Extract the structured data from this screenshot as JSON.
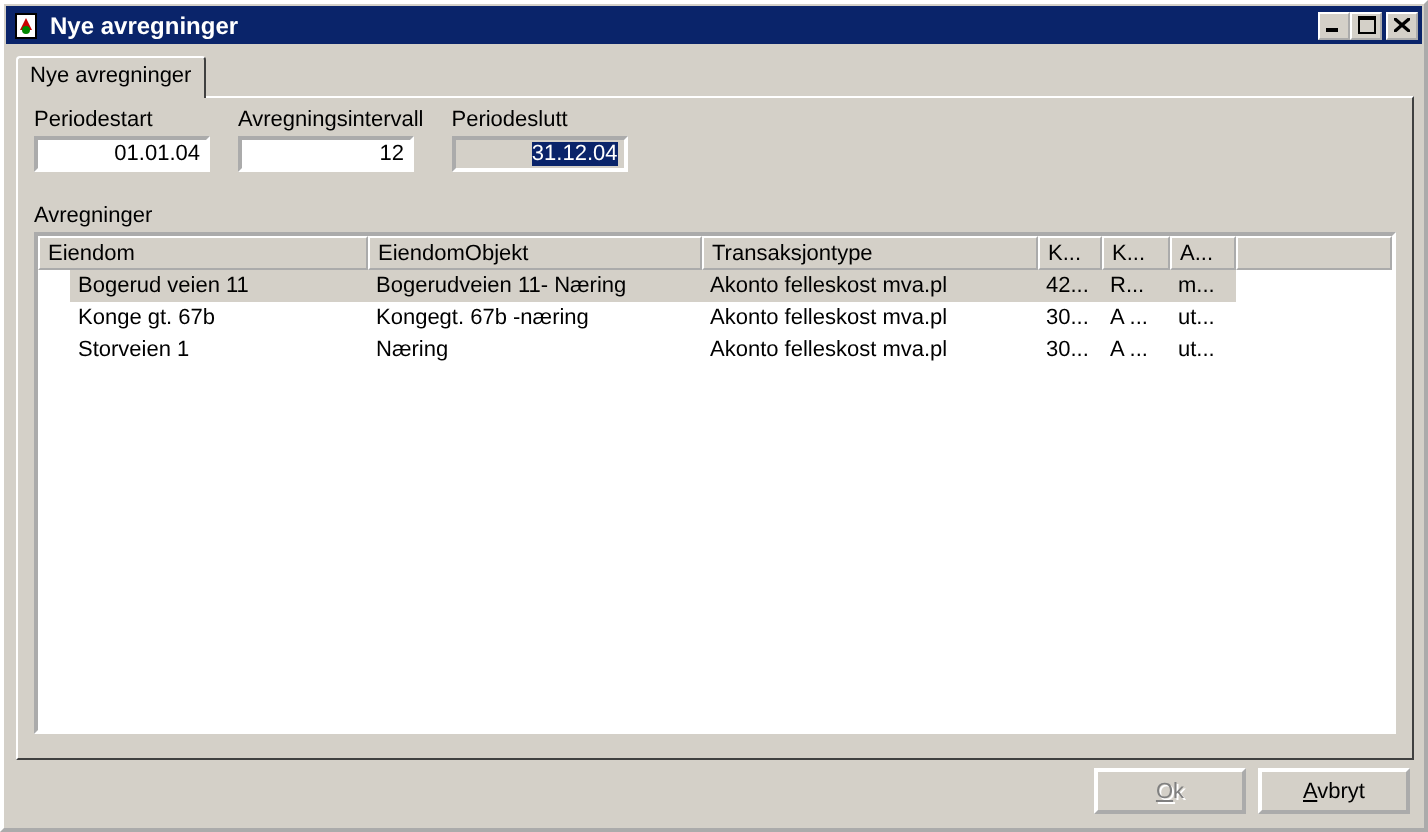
{
  "window": {
    "title": "Nye avregninger"
  },
  "tabs": [
    {
      "label": "Nye avregninger",
      "selected": true
    }
  ],
  "fields": [
    {
      "label": "Periodestart",
      "value": "01.01.04",
      "disabled": false,
      "text_selected": false
    },
    {
      "label": "Avregningsintervall",
      "value": "12",
      "disabled": false,
      "text_selected": false
    },
    {
      "label": "Periodeslutt",
      "value": "31.12.04",
      "disabled": true,
      "text_selected": true
    }
  ],
  "table": {
    "title": "Avregninger",
    "columns": [
      "Eiendom",
      "EiendomObjekt",
      "Transaksjontype",
      "K...",
      "K...",
      "A..."
    ],
    "rows": [
      {
        "cells": [
          "Bogerud veien 11",
          "Bogerudveien 11- Næring",
          "Akonto felleskost mva.pl",
          "42...",
          "R...",
          "m..."
        ],
        "selected": true
      },
      {
        "cells": [
          "Konge gt. 67b",
          "Kongegt. 67b -næring",
          "Akonto felleskost mva.pl",
          "30...",
          "A ...",
          "ut..."
        ],
        "selected": false
      },
      {
        "cells": [
          "Storveien 1",
          "Næring",
          "Akonto felleskost mva.pl",
          "30...",
          "A ...",
          "ut..."
        ],
        "selected": false
      }
    ]
  },
  "buttons": [
    {
      "label": "Ok",
      "disabled": true
    },
    {
      "label": "Avbryt",
      "disabled": false
    }
  ]
}
